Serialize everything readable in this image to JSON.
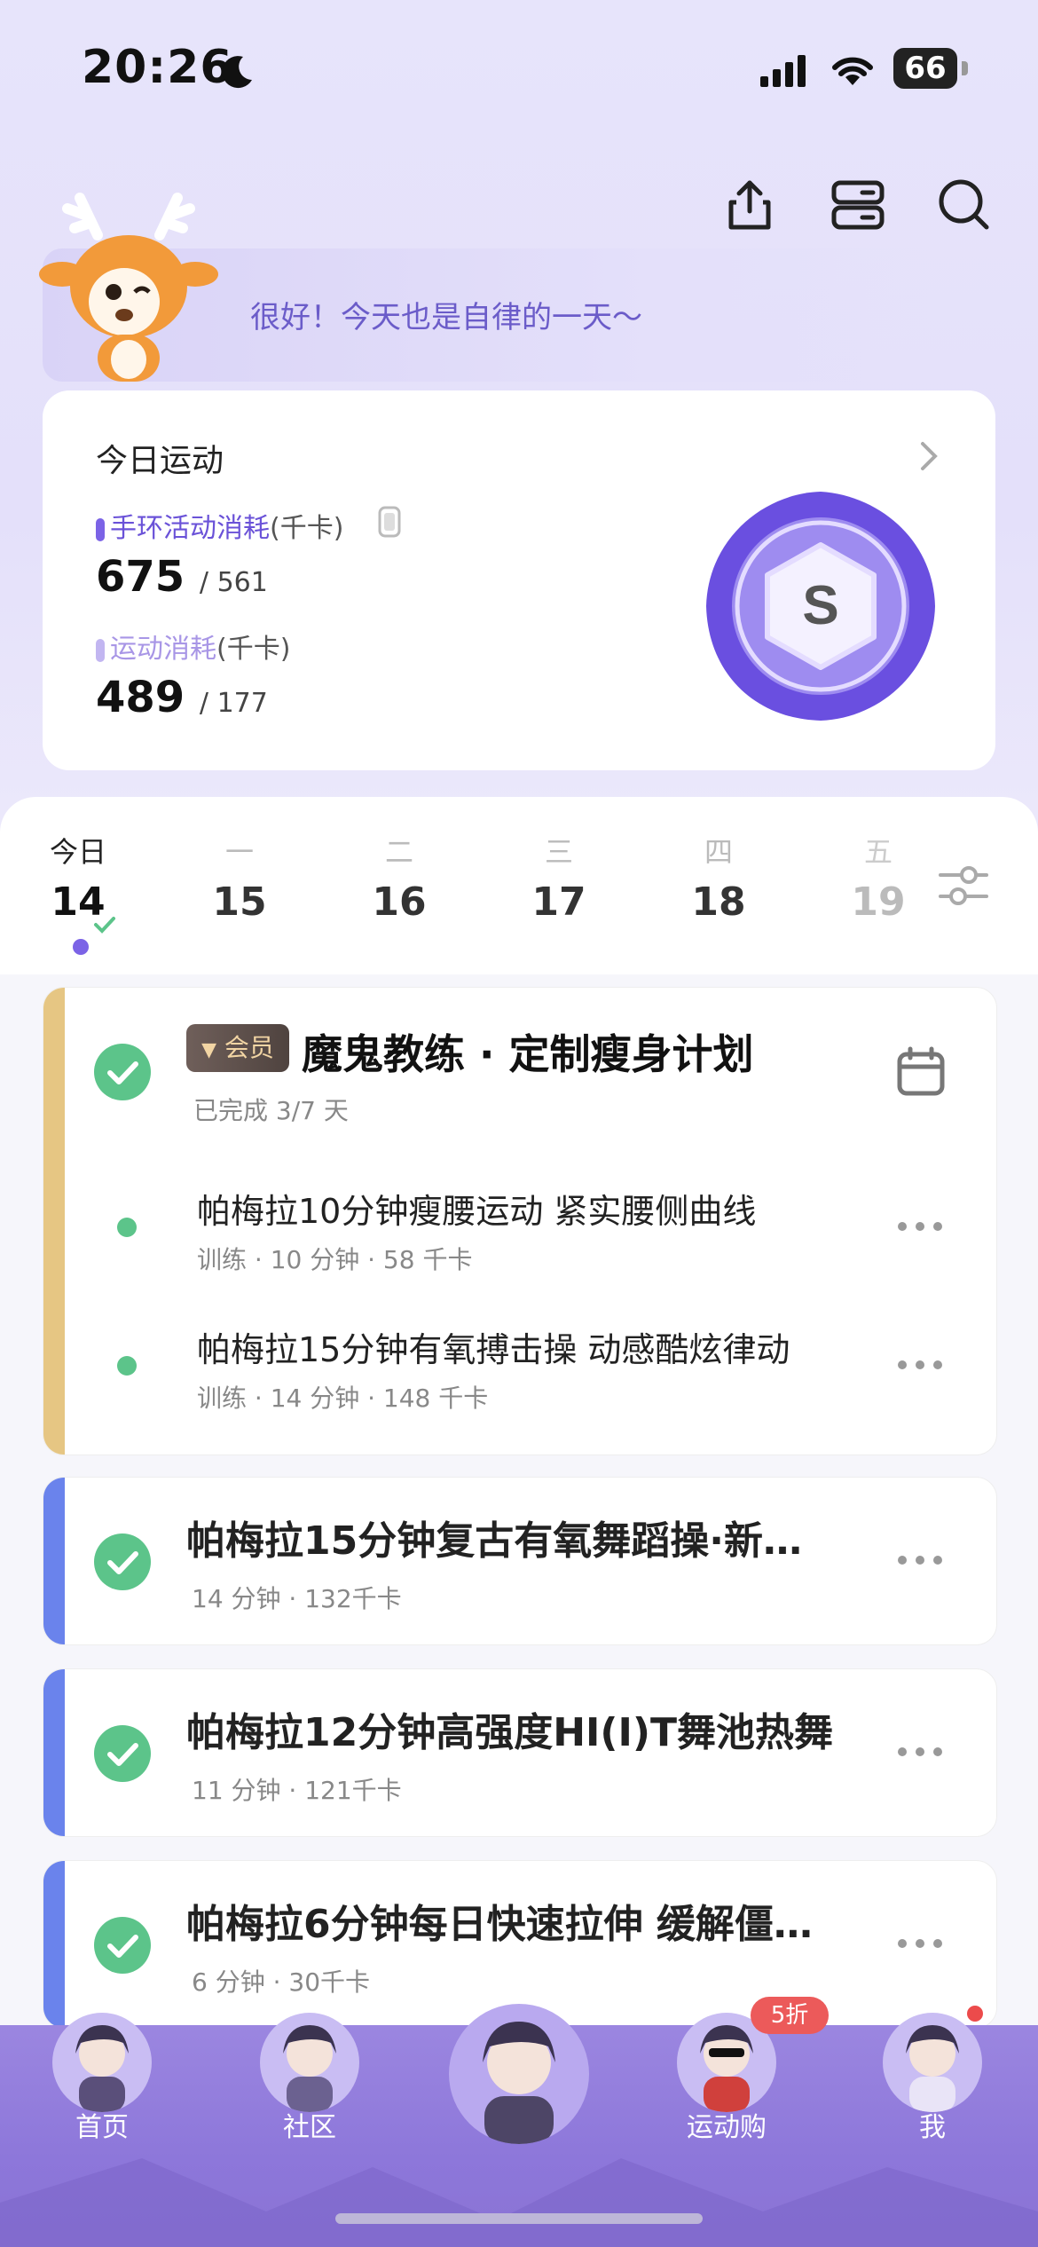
{
  "status_bar": {
    "time": "20:26",
    "battery": "66"
  },
  "greeting": {
    "text": "很好！今天也是自律的一天～"
  },
  "today": {
    "title": "今日运动",
    "band_label": "手环活动消耗",
    "band_unit": "(千卡)",
    "band_value": "675",
    "band_target": "/ 561",
    "sport_label": "运动消耗",
    "sport_unit": "(千卡)",
    "sport_value": "489",
    "sport_target": "/ 177",
    "badge_letter": "S"
  },
  "days": [
    {
      "name": "今日",
      "num": "14"
    },
    {
      "name": "一",
      "num": "15"
    },
    {
      "name": "二",
      "num": "16"
    },
    {
      "name": "三",
      "num": "17"
    },
    {
      "name": "四",
      "num": "18"
    },
    {
      "name": "五",
      "num": "19"
    }
  ],
  "plan": {
    "vip_label": "会员",
    "title": "魔鬼教练 · 定制瘦身计划",
    "progress": "已完成 3/7 天",
    "items": [
      {
        "title": "帕梅拉10分钟瘦腰运动 紧实腰侧曲线",
        "meta": "训练 · 10 分钟 · 58 千卡"
      },
      {
        "title": "帕梅拉15分钟有氧搏击操 动感酷炫律动",
        "meta": "训练 · 14 分钟 · 148 千卡"
      }
    ]
  },
  "workouts": [
    {
      "title": "帕梅拉15分钟复古有氧舞蹈操·新…",
      "meta": "14 分钟 · 132千卡"
    },
    {
      "title": "帕梅拉12分钟高强度HI(I)T舞池热舞",
      "meta": "11 分钟 · 121千卡"
    },
    {
      "title": "帕梅拉6分钟每日快速拉伸 缓解僵…",
      "meta": "6 分钟 · 30千卡"
    }
  ],
  "tabs": {
    "home": "首页",
    "community": "社区",
    "shop": "运动购",
    "me": "我",
    "sale_badge": "5折"
  },
  "colors": {
    "accent": "#7b63e6",
    "check_green": "#5cc48a",
    "plan_stripe": "#e6c683",
    "workout_stripe": "#6a83ec",
    "sale_red": "#ec5a5a"
  }
}
